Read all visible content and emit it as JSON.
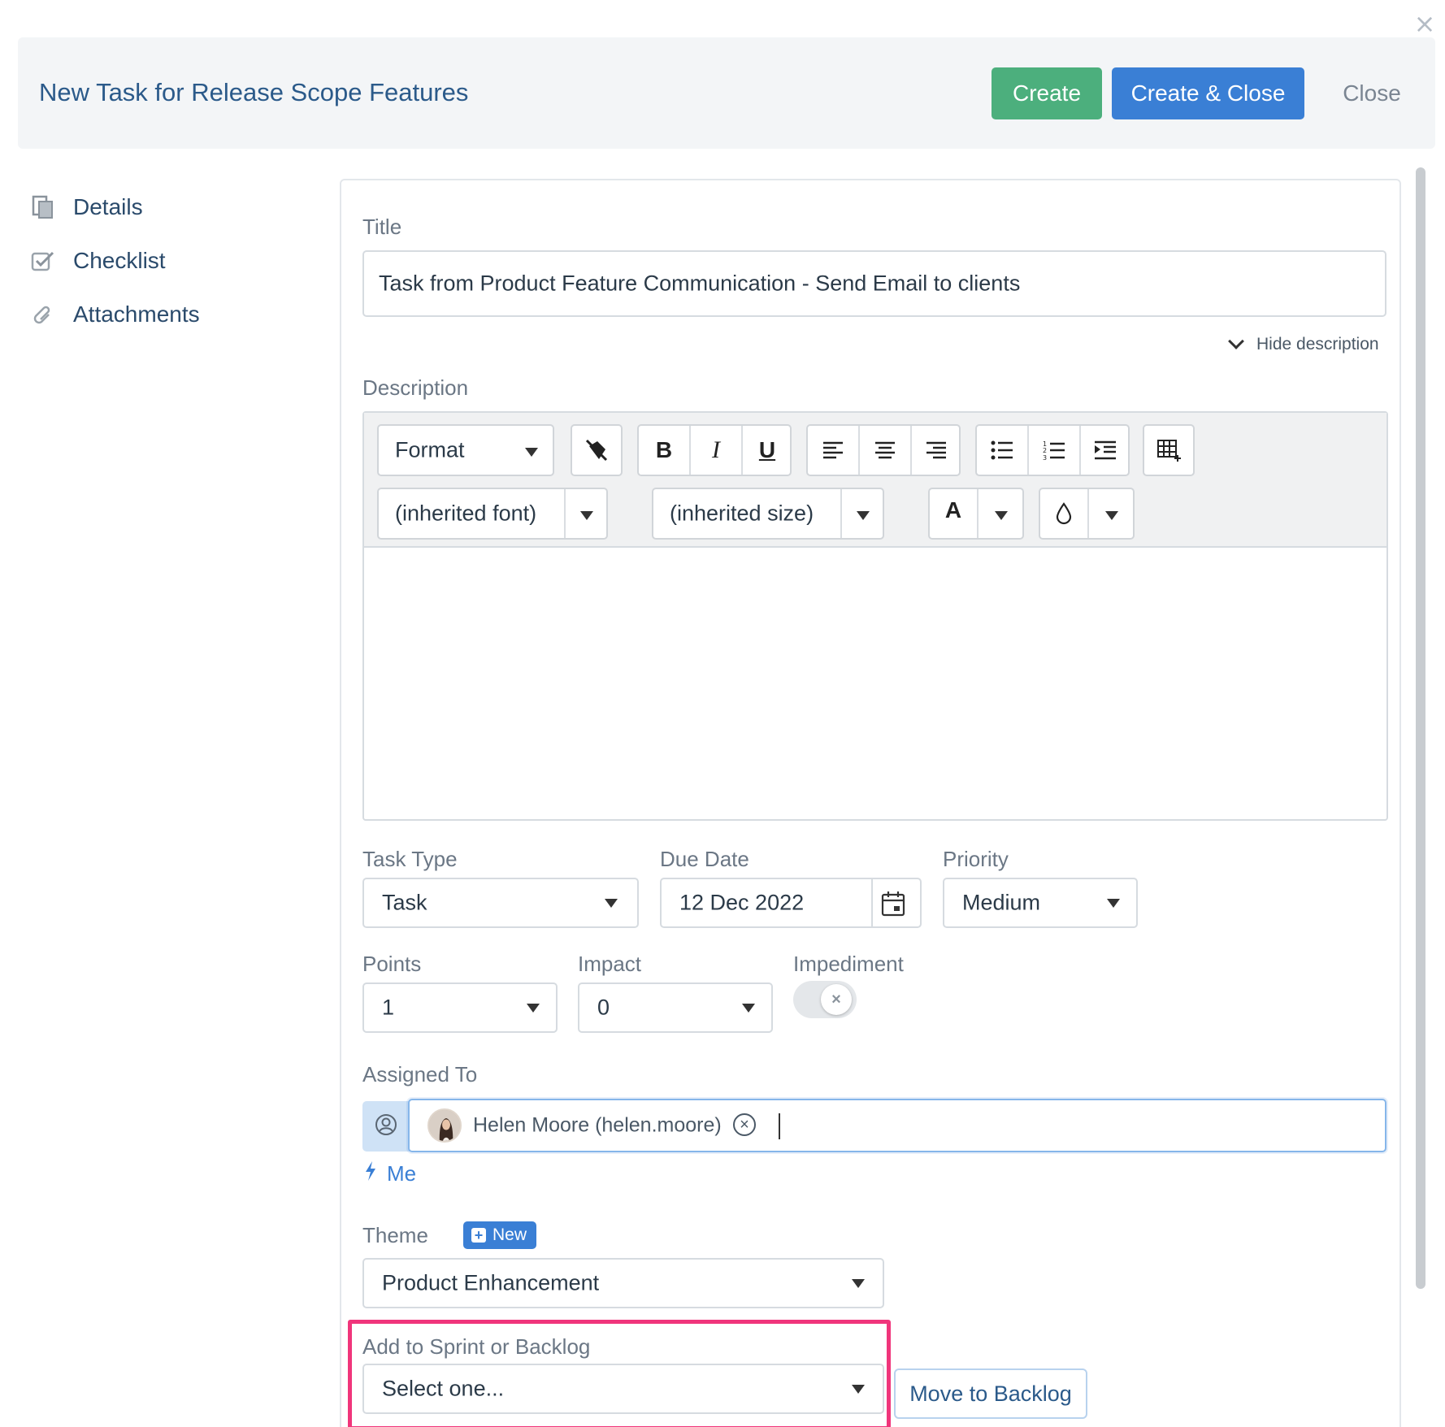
{
  "header": {
    "title": "New Task for Release Scope Features",
    "create_label": "Create",
    "create_close_label": "Create & Close",
    "close_label": "Close",
    "dismiss_glyph": "×"
  },
  "sidenav": {
    "items": [
      {
        "label": "Details",
        "icon": "documents-icon"
      },
      {
        "label": "Checklist",
        "icon": "checkbox-icon"
      },
      {
        "label": "Attachments",
        "icon": "paperclip-icon"
      }
    ]
  },
  "form": {
    "title_label": "Title",
    "title_value": "Task from Product Feature Communication - Send Email to clients",
    "hide_description": "Hide description",
    "description_label": "Description",
    "toolbar": {
      "format": "Format",
      "font": "(inherited font)",
      "size": "(inherited size)",
      "bold": "B",
      "italic": "I",
      "underline": "U",
      "text_color": "A"
    },
    "task_type_label": "Task Type",
    "task_type_value": "Task",
    "due_date_label": "Due Date",
    "due_date_value": "12 Dec 2022",
    "priority_label": "Priority",
    "priority_value": "Medium",
    "points_label": "Points",
    "points_value": "1",
    "impact_label": "Impact",
    "impact_value": "0",
    "impediment_label": "Impediment",
    "impediment_on": false,
    "assigned_label": "Assigned To",
    "assignee": "Helen Moore (helen.moore)",
    "me_link": "Me",
    "theme_label": "Theme",
    "theme_new": "New",
    "theme_value": "Product Enhancement",
    "sprint_label": "Add to Sprint or Backlog",
    "sprint_value": "Select one...",
    "move_backlog": "Move to Backlog"
  },
  "colors": {
    "create": "#4caf7d",
    "create_close": "#3a7fd5",
    "highlight": "#f0357b",
    "title_text": "#2b5a8a"
  }
}
